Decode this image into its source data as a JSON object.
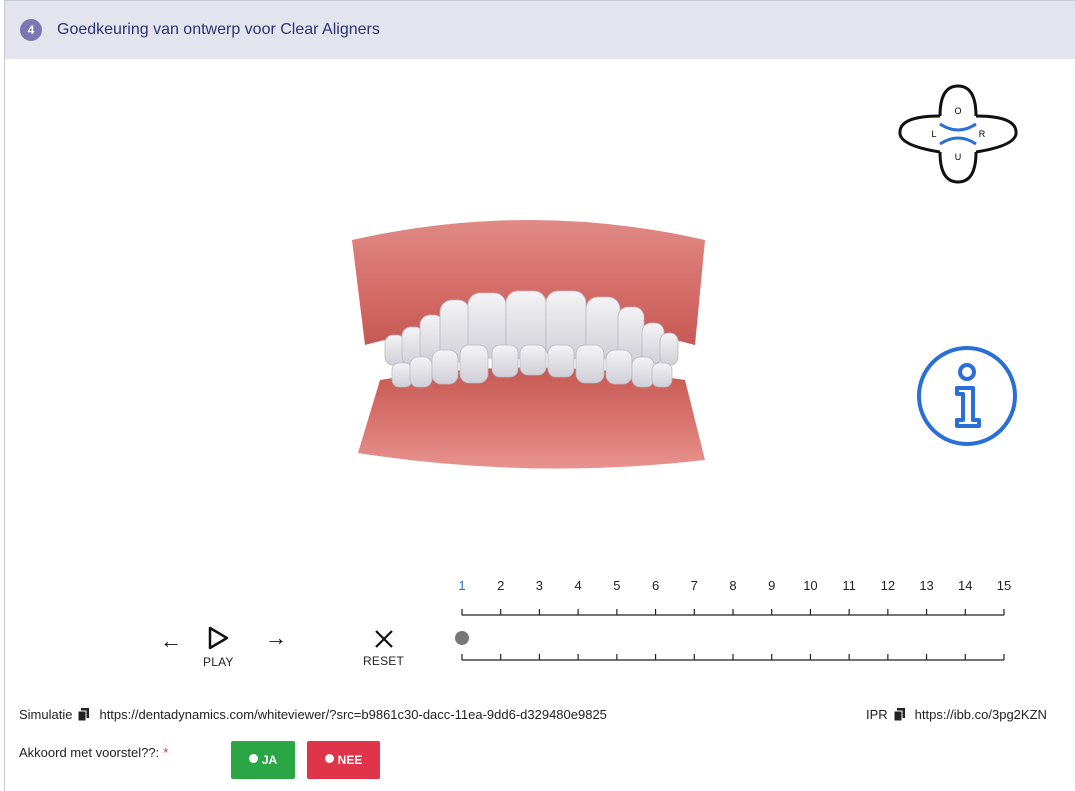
{
  "header": {
    "step": "4",
    "title": "Goedkeuring van ontwerp voor Clear Aligners"
  },
  "orientation": {
    "top": "O",
    "left": "L",
    "right": "R",
    "bottom": "U"
  },
  "controls": {
    "prev_arrow": "←",
    "next_arrow": "→",
    "play_label": "PLAY",
    "reset_label": "RESET"
  },
  "timeline": {
    "steps": [
      "1",
      "2",
      "3",
      "4",
      "5",
      "6",
      "7",
      "8",
      "9",
      "10",
      "11",
      "12",
      "13",
      "14",
      "15"
    ],
    "current": 1
  },
  "links": {
    "simulation_label": "Simulatie",
    "simulation_url": "https://dentadynamics.com/whiteviewer/?src=b9861c30-dacc-11ea-9dd6-d329480e9825",
    "ipr_label": "IPR",
    "ipr_url": "https://ibb.co/3pg2KZN"
  },
  "approval": {
    "question": "Akkoord met voorstel??:",
    "required_mark": "*",
    "yes_label": "JA",
    "no_label": "NEE"
  },
  "colors": {
    "accent": "#2a6fd6",
    "yes": "#2aa645",
    "no": "#e0344a",
    "header_bg": "#e4e4ee",
    "badge": "#7a77b3"
  }
}
